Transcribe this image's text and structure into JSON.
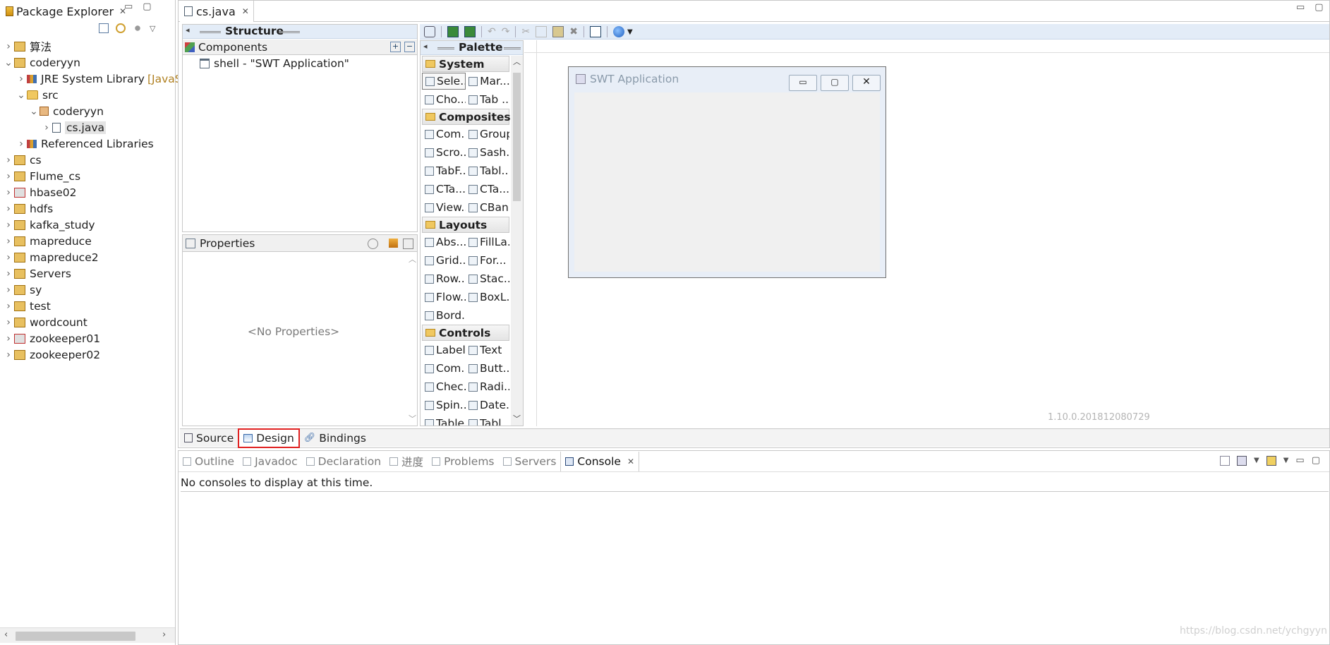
{
  "package_explorer": {
    "title": "Package Explorer",
    "tree": [
      {
        "label": "算法",
        "indent": 0,
        "twist": ">"
      },
      {
        "label": "coderyyn",
        "indent": 0,
        "twist": "v"
      },
      {
        "label": "JRE System Library",
        "suffix": "[JavaS",
        "indent": 1,
        "twist": ">"
      },
      {
        "label": "src",
        "indent": 1,
        "twist": "v"
      },
      {
        "label": "coderyyn",
        "indent": 2,
        "twist": "v"
      },
      {
        "label": "cs.java",
        "indent": 3,
        "twist": ">"
      },
      {
        "label": "Referenced Libraries",
        "indent": 1,
        "twist": ">"
      },
      {
        "label": "cs",
        "indent": 0,
        "twist": ">"
      },
      {
        "label": "Flume_cs",
        "indent": 0,
        "twist": ">"
      },
      {
        "label": "hbase02",
        "indent": 0,
        "twist": ">"
      },
      {
        "label": "hdfs",
        "indent": 0,
        "twist": ">"
      },
      {
        "label": "kafka_study",
        "indent": 0,
        "twist": ">"
      },
      {
        "label": "mapreduce",
        "indent": 0,
        "twist": ">"
      },
      {
        "label": "mapreduce2",
        "indent": 0,
        "twist": ">"
      },
      {
        "label": "Servers",
        "indent": 0,
        "twist": ">"
      },
      {
        "label": "sy",
        "indent": 0,
        "twist": ">"
      },
      {
        "label": "test",
        "indent": 0,
        "twist": ">"
      },
      {
        "label": "wordcount",
        "indent": 0,
        "twist": ">"
      },
      {
        "label": "zookeeper01",
        "indent": 0,
        "twist": ">"
      },
      {
        "label": "zookeeper02",
        "indent": 0,
        "twist": ">"
      }
    ]
  },
  "editor": {
    "tab_label": "cs.java",
    "structure": {
      "title": "Structure",
      "components_label": "Components",
      "tree_item": "shell - \"SWT Application\""
    },
    "properties": {
      "title": "Properties",
      "empty_text": "<No Properties>"
    },
    "palette": {
      "title": "Palette",
      "categories": [
        {
          "name": "System",
          "items": [
            [
              "Sele...",
              "Mar..."
            ],
            [
              "Cho...",
              "Tab ..."
            ]
          ]
        },
        {
          "name": "Composites",
          "items": [
            [
              "Com...",
              "Group"
            ],
            [
              "Scro...",
              "Sash..."
            ],
            [
              "TabF...",
              "Tabl..."
            ],
            [
              "CTa...",
              "CTa..."
            ],
            [
              "View...",
              "CBan..."
            ]
          ]
        },
        {
          "name": "Layouts",
          "items": [
            [
              "Abs...",
              "FillLa..."
            ],
            [
              "Grid...",
              "For..."
            ],
            [
              "Row...",
              "Stac..."
            ],
            [
              "Flow...",
              "BoxL..."
            ],
            [
              "Bord...",
              ""
            ]
          ]
        },
        {
          "name": "Controls",
          "items": [
            [
              "Label",
              "Text"
            ],
            [
              "Com...",
              "Butt..."
            ],
            [
              "Chec...",
              "Radi..."
            ],
            [
              "Spin...",
              "Date..."
            ],
            [
              "Table",
              "Tabl"
            ]
          ]
        }
      ]
    },
    "design_canvas": {
      "window_title": "SWT Application",
      "version": "1.10.0.201812080729"
    },
    "bottom_tabs": [
      "Source",
      "Design",
      "Bindings"
    ]
  },
  "console_panel": {
    "tabs": [
      "Outline",
      "Javadoc",
      "Declaration",
      "进度",
      "Problems",
      "Servers",
      "Console"
    ],
    "message": "No consoles to display at this time."
  },
  "watermark": "https://blog.csdn.net/ychgyyn"
}
